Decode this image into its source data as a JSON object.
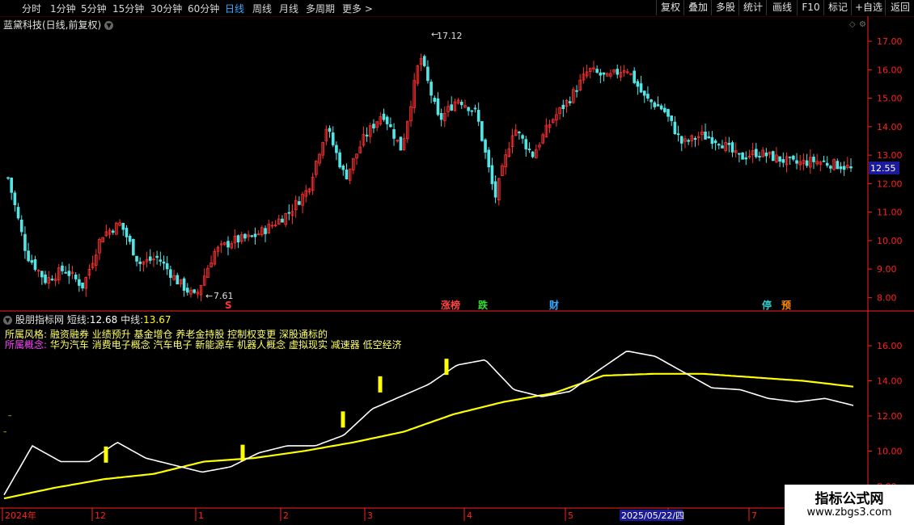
{
  "toolbar": {
    "periods": [
      "分时",
      "1分钟",
      "5分钟",
      "15分钟",
      "30分钟",
      "60分钟",
      "日线",
      "周线",
      "月线",
      "多周期",
      "更多 >"
    ],
    "active_period": "日线",
    "tools": [
      "复权",
      "叠加",
      "多股",
      "统计",
      "画线",
      "F10",
      "标记",
      "+自选",
      "返回"
    ]
  },
  "stock": {
    "title": "蓝黛科技(日线,前复权)",
    "current_price": "12.55",
    "high_label": "17.12",
    "low_label": "7.61"
  },
  "events": [
    {
      "label": "S",
      "color": "#ff3333"
    },
    {
      "label": "涨榜",
      "color": "#ff4444"
    },
    {
      "label": "跌",
      "color": "#33dd33"
    },
    {
      "label": "财",
      "color": "#3aa8ff"
    },
    {
      "label": "停",
      "color": "#33cccc"
    },
    {
      "label": "预",
      "color": "#ff8800"
    }
  ],
  "indicator": {
    "name": "股朋指标网",
    "short_label": "短线:",
    "short_value": "12.68",
    "mid_label": "中线:",
    "mid_value": "13.67",
    "style_label": "所属风格:",
    "style_text": "融资融券 业绩预升 基金增仓 养老金持股 控制权变更 深股通标的",
    "concept_label": "所属概念:",
    "concept_text": "华为汽车 消费电子概念 汽车电子 新能源车 机器人概念 虚拟现实 减速器 低空经济"
  },
  "date_axis": {
    "labels": [
      "2024年",
      "12",
      "1",
      "2",
      "3",
      "4",
      "5",
      "6",
      "7"
    ],
    "cursor_date": "2025/05/22/四"
  },
  "watermark": {
    "line1": "指标公式网",
    "line2": "www.zbgs3.com"
  },
  "colors": {
    "up": "#ff3030",
    "down": "#54e6e6",
    "short_line": "#ffffff",
    "mid_line": "#ffff00",
    "axis": "#ff2020"
  },
  "chart_data": [
    {
      "type": "candlestick",
      "title": "蓝黛科技(日线,前复权)",
      "ylim": [
        7.5,
        17.4
      ],
      "yticks": [
        8.0,
        9.0,
        10.0,
        11.0,
        12.0,
        13.0,
        14.0,
        15.0,
        16.0,
        17.0
      ],
      "ytick_labels": [
        "8.00",
        "9.00",
        "10.00",
        "11.00",
        "12.00",
        "13.00",
        "14.00",
        "15.00",
        "16.00",
        "17.00"
      ],
      "anchor_prices": [
        12.2,
        9.5,
        8.6,
        9.0,
        8.4,
        10.2,
        10.6,
        9.2,
        9.4,
        8.6,
        8.0,
        9.6,
        10.0,
        10.1,
        10.5,
        11.0,
        11.8,
        14.0,
        12.2,
        13.6,
        14.5,
        13.2,
        16.5,
        14.2,
        15.0,
        14.5,
        11.5,
        14.0,
        13.0,
        14.2,
        15.0,
        16.0,
        15.7,
        16.1,
        15.0,
        14.6,
        13.4,
        13.7,
        13.5,
        12.9,
        13.1,
        12.9,
        12.7,
        12.8,
        12.7,
        12.55
      ],
      "close": 12.55
    },
    {
      "type": "line",
      "ylim": [
        6.8,
        17.2
      ],
      "yticks": [
        8.0,
        10.0,
        12.0,
        14.0,
        16.0
      ],
      "ytick_labels": [
        "8.00",
        "10.00",
        "12.00",
        "14.00",
        "16.00"
      ],
      "series": [
        {
          "name": "短线",
          "anchors": [
            7.5,
            10.3,
            9.4,
            9.4,
            10.5,
            9.6,
            9.2,
            8.8,
            9.1,
            9.9,
            10.3,
            10.3,
            10.9,
            12.4,
            13.1,
            13.8,
            14.9,
            15.2,
            13.5,
            13.1,
            13.4,
            14.6,
            15.7,
            15.4,
            14.5,
            13.6,
            13.5,
            13.0,
            12.8,
            13.0,
            12.6
          ],
          "final": 12.68
        },
        {
          "name": "中线",
          "anchors": [
            7.3,
            7.9,
            8.4,
            8.7,
            9.4,
            9.6,
            10.0,
            10.5,
            11.1,
            12.1,
            12.8,
            13.3,
            14.3,
            14.4,
            14.4,
            14.2,
            14.0,
            13.67
          ],
          "final": 13.67
        }
      ],
      "signal_markers": [
        9.8,
        9.9,
        11.8,
        13.8,
        14.8
      ]
    }
  ]
}
